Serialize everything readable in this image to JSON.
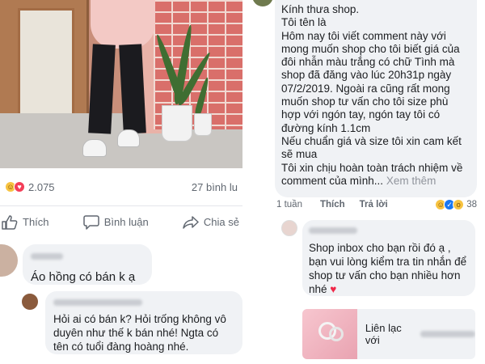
{
  "post": {
    "reaction_count": "2.075",
    "comment_count": "27 bình lu",
    "actions": {
      "like": "Thích",
      "comment": "Bình luận",
      "share": "Chia sẻ"
    }
  },
  "left_comments": [
    {
      "text": "Áo hồng có bán k ạ"
    },
    {
      "text": "Hỏi ai có bán k? Hỏi trống không vô duyên như thế k bán nhé! Ngta có tên có tuổi đàng hoàng nhé."
    }
  ],
  "right_comment": {
    "text": "Kính thưa shop.\nTôi tên là\nHôm nay tôi viết comment này với mong muốn shop cho tôi biết giá của đôi nhẫn màu trắng có chữ Tình mà shop đã đăng vào lúc 20h31p ngày 07/2/2019. Ngoài ra cũng rất mong muốn shop tư vấn cho tôi size phù hợp với ngón tay, ngón tay tôi có đường kính 1.1cm\nNếu chuẩn giá và size tôi xin cam kết sẽ mua\nTôi xin chịu hoàn toàn trách nhiệm về comment của mình...",
    "more_label": "Xem thêm",
    "age": "1 tuần",
    "like_label": "Thích",
    "reply_label": "Trả lời",
    "reaction_count": "38"
  },
  "shop_reply": {
    "text": "Shop inbox cho bạn rồi đó ạ , bạn vui lòng kiểm tra tin nhắn để shop tư vấn cho bạn nhiều hơn nhé",
    "heart": "♥"
  },
  "contact_card": {
    "label": "Liên lạc với"
  },
  "colors": {
    "bubble": "#f0f2f5",
    "meta_text": "#606770",
    "heart": "#f02849"
  },
  "icons": [
    "haha-icon",
    "love-icon",
    "like-icon",
    "wow-icon",
    "thumbs-up-icon",
    "comment-icon",
    "share-icon"
  ]
}
